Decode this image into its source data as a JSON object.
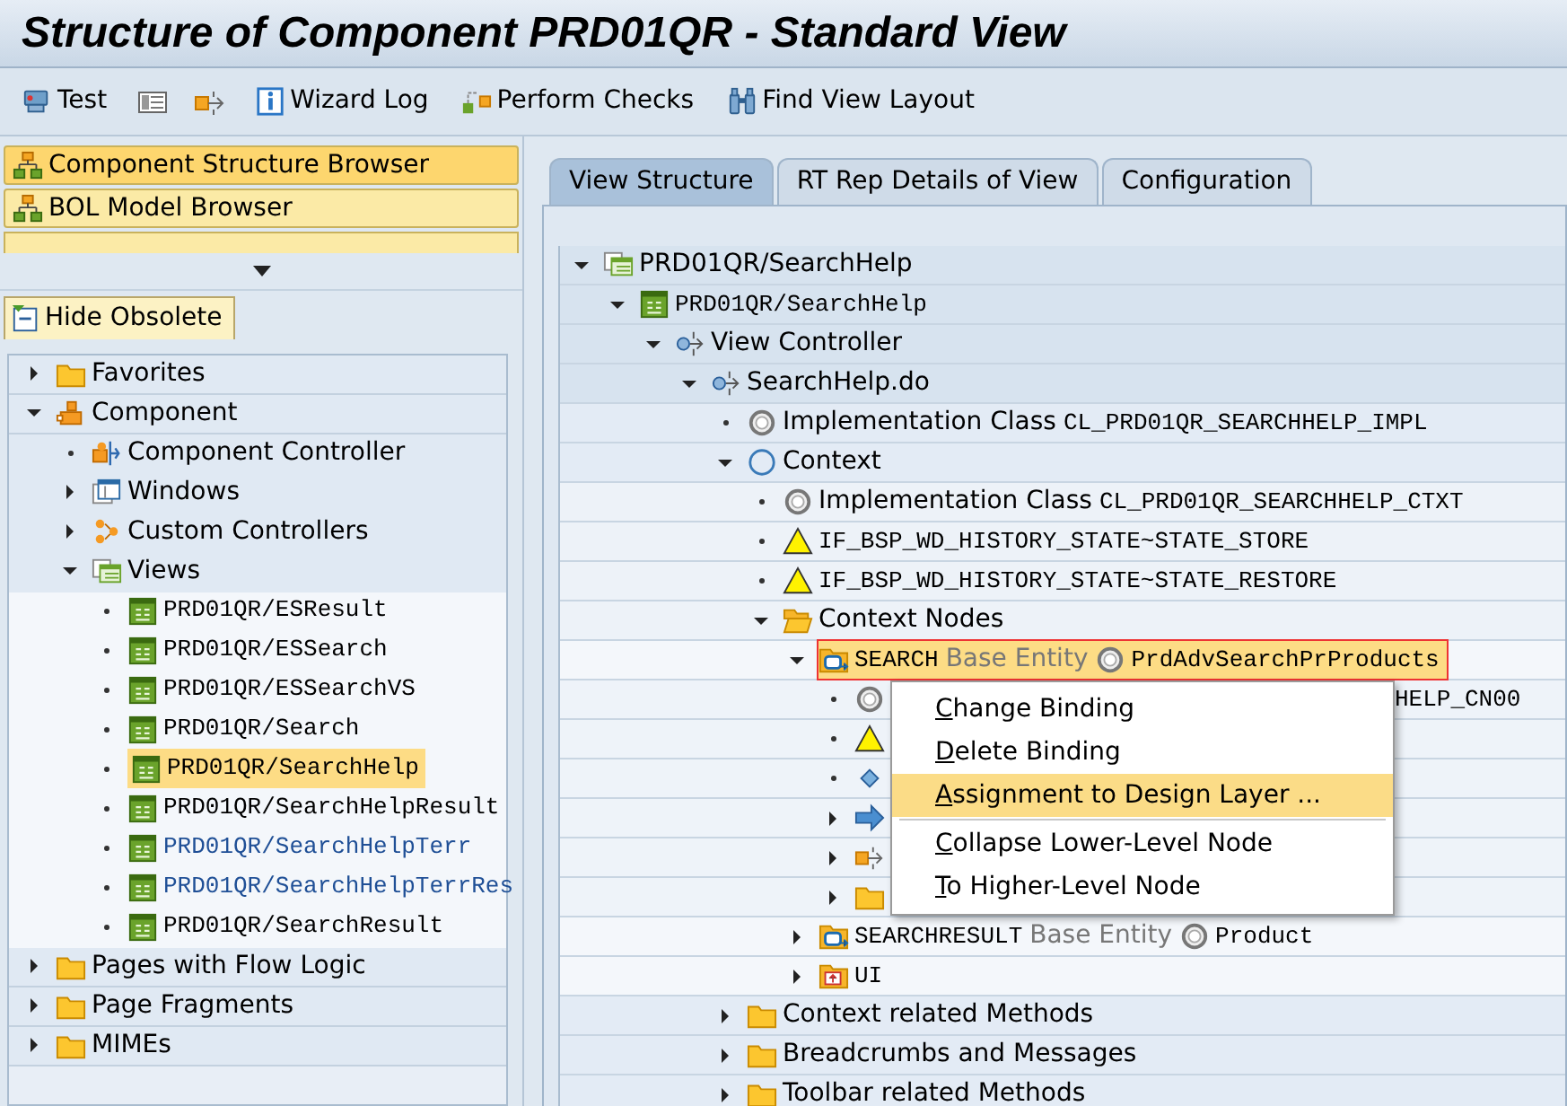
{
  "window": {
    "title": "Structure of Component PRD01QR - Standard View"
  },
  "toolbar": [
    {
      "kind": "test",
      "label": "Test"
    },
    {
      "kind": "list"
    },
    {
      "kind": "export"
    },
    {
      "kind": "info",
      "label": "Wizard Log"
    },
    {
      "kind": "check",
      "label": "Perform Checks"
    },
    {
      "kind": "binoculars",
      "label": "Find View Layout"
    }
  ],
  "browsers": [
    {
      "label": "Component Structure Browser",
      "selected": true
    },
    {
      "label": "BOL Model Browser",
      "selected": false
    }
  ],
  "filter_tab": {
    "label": "Hide Obsolete"
  },
  "left_tree": [
    {
      "kind": "folder",
      "label": "Favorites",
      "expanded": false,
      "selected": false
    },
    {
      "kind": "component",
      "label": "Component",
      "expanded": true,
      "selected": false,
      "children": [
        {
          "kind": "controller",
          "label": "Component Controller",
          "selected": false
        },
        {
          "kind": "window",
          "label": "Windows",
          "expanded": false,
          "selected": false
        },
        {
          "kind": "custom",
          "label": "Custom Controllers",
          "expanded": false,
          "selected": false
        },
        {
          "kind": "views",
          "label": "Views",
          "expanded": true,
          "selected": false,
          "children": [
            {
              "kind": "view",
              "code": "PRD01QR/ESResult",
              "color": "#000000",
              "selected": false
            },
            {
              "kind": "view",
              "code": "PRD01QR/ESSearch",
              "color": "#000000",
              "selected": false
            },
            {
              "kind": "view",
              "code": "PRD01QR/ESSearchVS",
              "color": "#000000",
              "selected": false
            },
            {
              "kind": "view",
              "code": "PRD01QR/Search",
              "color": "#000000",
              "selected": false
            },
            {
              "kind": "view",
              "code": "PRD01QR/SearchHelp",
              "color": "#000000",
              "selected": true
            },
            {
              "kind": "view",
              "code": "PRD01QR/SearchHelpResult",
              "color": "#000000",
              "selected": false
            },
            {
              "kind": "view",
              "code": "PRD01QR/SearchHelpTerr",
              "color": "#1f4f96",
              "selected": false
            },
            {
              "kind": "view",
              "code": "PRD01QR/SearchHelpTerrRes",
              "color": "#1f4f96",
              "selected": false
            },
            {
              "kind": "view",
              "code": "PRD01QR/SearchResult",
              "color": "#000000",
              "selected": false
            }
          ]
        }
      ]
    },
    {
      "kind": "folder",
      "label": "Pages with Flow Logic",
      "expanded": false,
      "selected": false
    },
    {
      "kind": "folder",
      "label": "Page Fragments",
      "expanded": false,
      "selected": false
    },
    {
      "kind": "folder",
      "label": "MIMEs",
      "expanded": false,
      "selected": false
    }
  ],
  "tabs": [
    {
      "label": "View Structure",
      "selected": true
    },
    {
      "label": "RT Rep Details of View",
      "selected": false
    },
    {
      "label": "Configuration",
      "selected": false
    }
  ],
  "view_tree": [
    {
      "kind": "views",
      "label": "PRD01QR/SearchHelp",
      "expanded": true,
      "selected": false,
      "children": [
        {
          "kind": "view",
          "code": "PRD01QR/SearchHelp",
          "expanded": true,
          "selected": false,
          "children": [
            {
              "kind": "vc",
              "label": "View Controller",
              "expanded": true,
              "selected": false,
              "children": [
                {
                  "kind": "vc",
                  "label": "SearchHelp.do",
                  "expanded": true,
                  "selected": false,
                  "children": [
                    {
                      "kind": "ring",
                      "label": "Implementation Class",
                      "code": "CL_PRD01QR_SEARCHHELP_IMPL",
                      "selected": false
                    },
                    {
                      "kind": "circle",
                      "label": "Context",
                      "expanded": true,
                      "selected": false,
                      "children": [
                        {
                          "kind": "ring",
                          "label": "Implementation Class",
                          "code": "CL_PRD01QR_SEARCHHELP_CTXT",
                          "selected": false
                        },
                        {
                          "kind": "warning",
                          "code": "IF_BSP_WD_HISTORY_STATE~STATE_STORE",
                          "selected": false
                        },
                        {
                          "kind": "warning",
                          "code": "IF_BSP_WD_HISTORY_STATE~STATE_RESTORE",
                          "selected": false
                        },
                        {
                          "kind": "folder-open",
                          "label": "Context Nodes",
                          "expanded": true,
                          "selected": false,
                          "children": [
                            {
                              "kind": "node",
                              "code": "SEARCH",
                              "base": "Base Entity",
                              "entity": "PrdAdvSearchPrProducts",
                              "expanded": true,
                              "selected": true,
                              "children": [
                                {
                                  "kind": "ring",
                                  "tail": "HELP_CN00",
                                  "selected": false
                                },
                                {
                                  "kind": "warning",
                                  "selected": false
                                },
                                {
                                  "kind": "diamond",
                                  "selected": false
                                },
                                {
                                  "kind": "arrow",
                                  "expanded": false,
                                  "selected": false
                                },
                                {
                                  "kind": "export",
                                  "expanded": false,
                                  "selected": false
                                },
                                {
                                  "kind": "folder",
                                  "expanded": false,
                                  "selected": false
                                }
                              ]
                            },
                            {
                              "kind": "node",
                              "code": "SEARCHRESULT",
                              "base": "Base Entity",
                              "entity": "Product",
                              "expanded": false,
                              "selected": false
                            },
                            {
                              "kind": "ui",
                              "code": "UI",
                              "expanded": false,
                              "selected": false
                            }
                          ]
                        }
                      ]
                    },
                    {
                      "kind": "folder",
                      "label": "Context related Methods",
                      "expanded": false,
                      "selected": false
                    },
                    {
                      "kind": "folder",
                      "label": "Breadcrumbs and Messages",
                      "expanded": false,
                      "selected": false
                    },
                    {
                      "kind": "folder",
                      "label": "Toolbar related Methods",
                      "expanded": false,
                      "selected": false
                    }
                  ]
                }
              ]
            }
          ]
        }
      ]
    }
  ],
  "context_menu": [
    {
      "kind": "item",
      "label": "Change Binding",
      "selected": false
    },
    {
      "kind": "item",
      "label": "Delete Binding",
      "selected": false
    },
    {
      "kind": "item",
      "label": "Assignment to Design Layer ...",
      "selected": true
    },
    {
      "kind": "separator"
    },
    {
      "kind": "item",
      "label": "Collapse Lower-Level Node",
      "selected": false
    },
    {
      "kind": "item",
      "label": "To Higher-Level Node",
      "selected": false
    }
  ]
}
